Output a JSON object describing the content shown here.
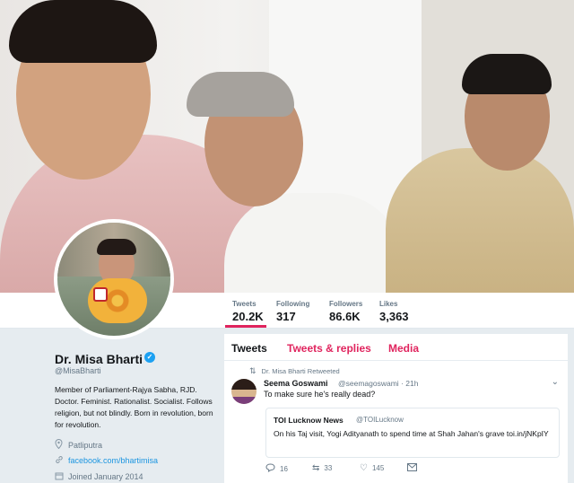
{
  "profile": {
    "name": "Dr. Misa Bharti",
    "handle": "@MisaBharti",
    "bio": "Member of Parliament-Rajya Sabha, RJD. Doctor. Feminist. Rationalist. Socialist. Follows religion, but not blindly. Born in revolution, born for revolution.",
    "location": "Patliputra",
    "website": "facebook.com/bhartimisa",
    "joined": "Joined January 2014",
    "verified_icon": "verified-badge-icon"
  },
  "stats": [
    {
      "label": "Tweets",
      "value": "20.2K"
    },
    {
      "label": "Following",
      "value": "317"
    },
    {
      "label": "Followers",
      "value": "86.6K"
    },
    {
      "label": "Likes",
      "value": "3,363"
    }
  ],
  "tabs": {
    "tweets": "Tweets",
    "replies": "Tweets & replies",
    "media": "Media"
  },
  "tweet": {
    "retweet_note": "Dr. Misa Bharti Retweeted",
    "author_name": "Seema Goswami",
    "author_handle": "@seemagoswami · 21h",
    "text": "To make sure he's really dead?",
    "quote": {
      "name": "TOI Lucknow News",
      "handle": "@TOILucknow",
      "text": "On his Taj visit, Yogi Adityanath to spend time at Shah Jahan's grave toi.in/jNKpIY"
    },
    "actions": {
      "replies": "16",
      "retweets": "33",
      "likes": "145"
    }
  },
  "colors": {
    "accent": "#e0245e",
    "link": "#1b95e0",
    "verified": "#1da1f2"
  }
}
